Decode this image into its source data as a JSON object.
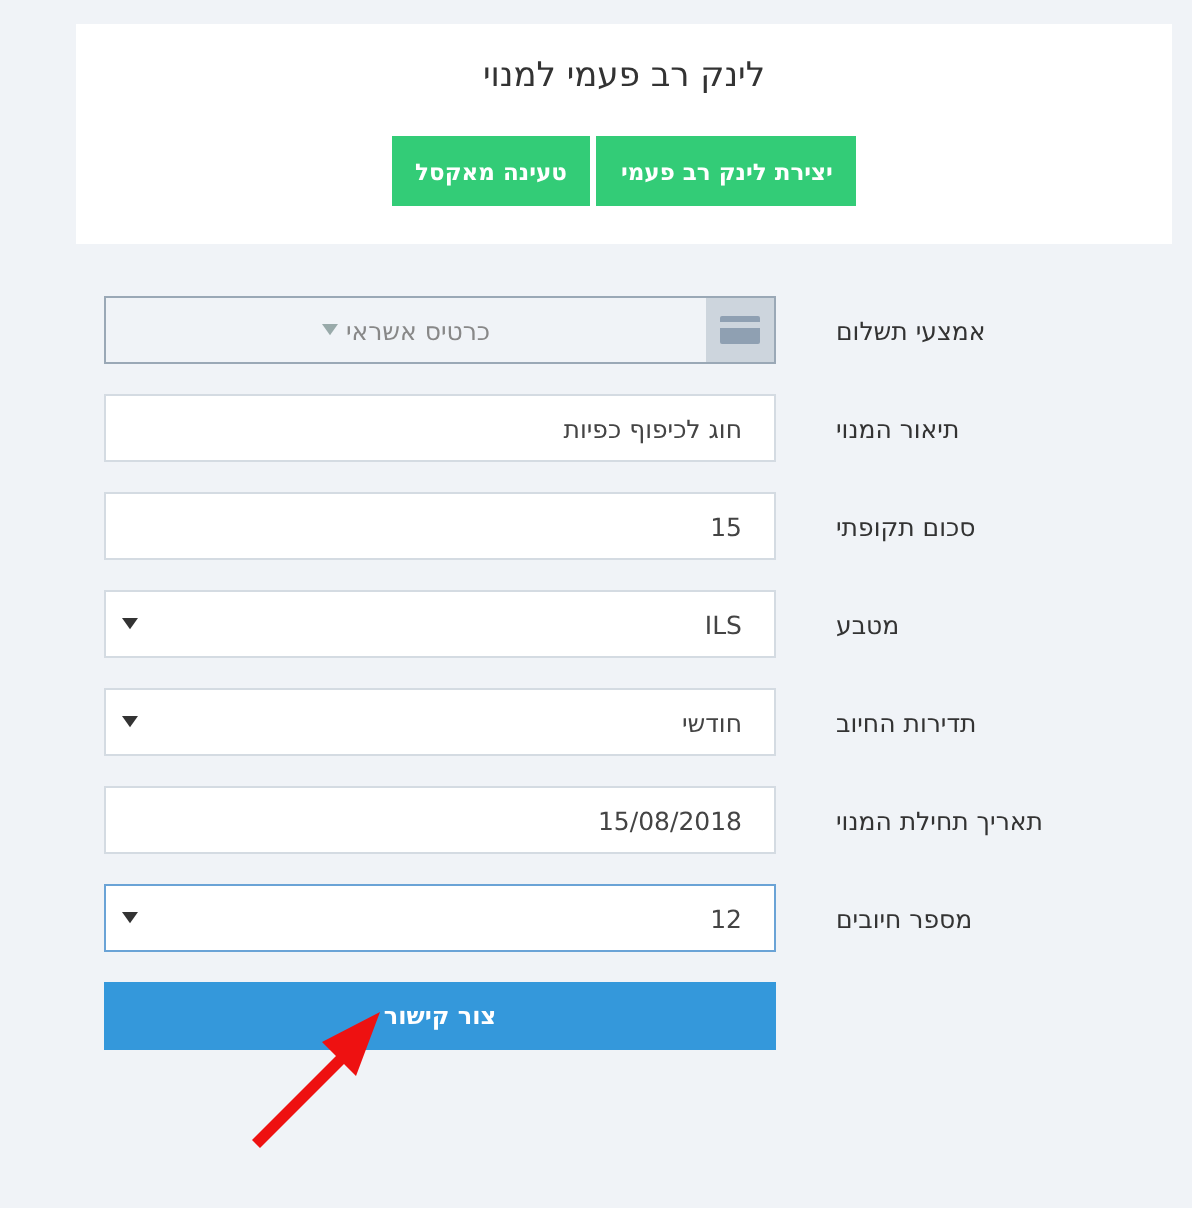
{
  "header": {
    "title": "לינק רב פעמי למנוי",
    "buttons": [
      "יצירת לינק רב פעמי",
      "טעינה מאקסל"
    ]
  },
  "fields": [
    {
      "label": "אמצעי תשלום",
      "kind": "payment",
      "value": "כרטיס אשראי",
      "focused": false
    },
    {
      "label": "תיאור המנוי",
      "kind": "text",
      "value": "חוג לכיפוף כפיות",
      "focused": false
    },
    {
      "label": "סכום תקופתי",
      "kind": "text",
      "value": "15",
      "focused": false
    },
    {
      "label": "מטבע",
      "kind": "select",
      "value": "ILS",
      "focused": false
    },
    {
      "label": "תדירות החיוב",
      "kind": "select",
      "value": "חודשי",
      "focused": false
    },
    {
      "label": "תאריך תחילת המנוי",
      "kind": "text",
      "value": "15/08/2018",
      "focused": false
    },
    {
      "label": "מספר חיובים",
      "kind": "select",
      "value": "12",
      "focused": true
    }
  ],
  "submit": "צור קישור"
}
